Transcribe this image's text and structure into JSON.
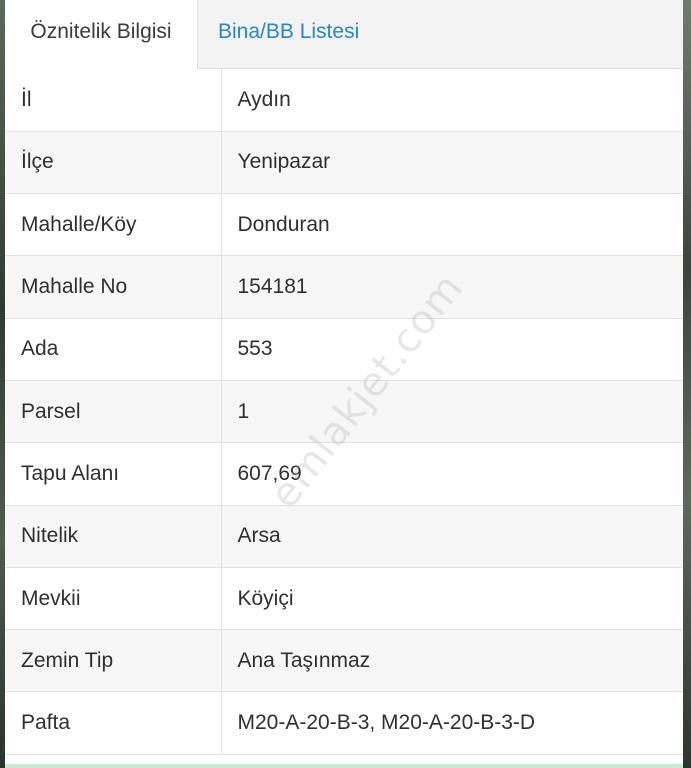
{
  "tabs": [
    {
      "label": "Öznitelik Bilgisi",
      "active": true
    },
    {
      "label": "Bina/BB Listesi",
      "active": false
    }
  ],
  "rows": [
    {
      "key": "İl",
      "value": "Aydın"
    },
    {
      "key": "İlçe",
      "value": "Yenipazar"
    },
    {
      "key": "Mahalle/Köy",
      "value": "Donduran"
    },
    {
      "key": "Mahalle No",
      "value": "154181"
    },
    {
      "key": "Ada",
      "value": "553"
    },
    {
      "key": "Parsel",
      "value": "1"
    },
    {
      "key": "Tapu Alanı",
      "value": "607,69"
    },
    {
      "key": "Nitelik",
      "value": "Arsa"
    },
    {
      "key": "Mevkii",
      "value": "Köyiçi"
    },
    {
      "key": "Zemin Tip",
      "value": "Ana Taşınmaz"
    },
    {
      "key": "Pafta",
      "value": "M20-A-20-B-3, M20-A-20-B-3-D"
    }
  ],
  "watermark": "emlakjet.com",
  "colors": {
    "tab_link": "#2a86c1",
    "text": "#2f2f2f",
    "border": "#e2e2e2"
  }
}
